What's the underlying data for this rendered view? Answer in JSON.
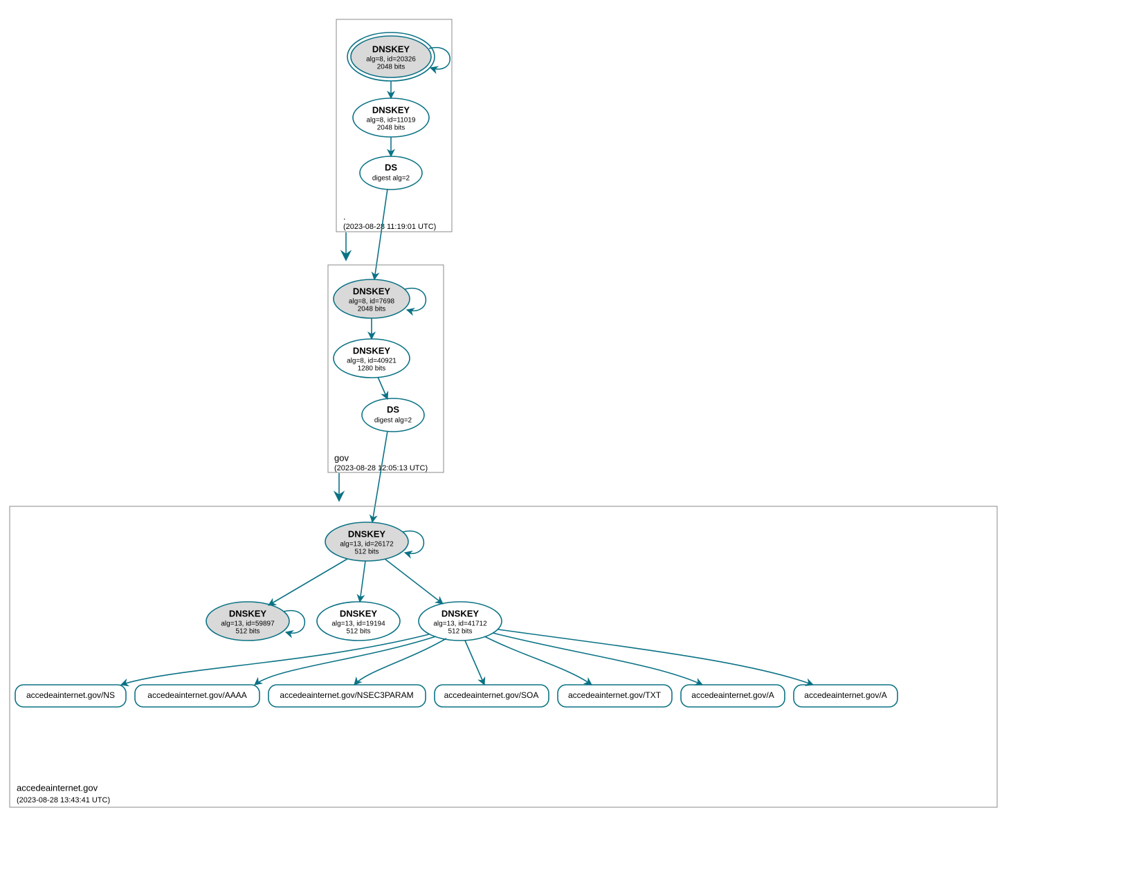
{
  "color_accent": "#0b7285",
  "color_fill_grey": "#d9d9d9",
  "zones": {
    "root": {
      "label": ".",
      "timestamp": "(2023-08-28 11:19:01 UTC)",
      "nodes": {
        "ksk": {
          "title": "DNSKEY",
          "line1": "alg=8, id=20326",
          "line2": "2048 bits"
        },
        "zsk": {
          "title": "DNSKEY",
          "line1": "alg=8, id=11019",
          "line2": "2048 bits"
        },
        "ds": {
          "title": "DS",
          "line1": "digest alg=2"
        }
      }
    },
    "gov": {
      "label": "gov",
      "timestamp": "(2023-08-28 12:05:13 UTC)",
      "nodes": {
        "ksk": {
          "title": "DNSKEY",
          "line1": "alg=8, id=7698",
          "line2": "2048 bits"
        },
        "zsk": {
          "title": "DNSKEY",
          "line1": "alg=8, id=40921",
          "line2": "1280 bits"
        },
        "ds": {
          "title": "DS",
          "line1": "digest alg=2"
        }
      }
    },
    "leaf": {
      "label": "accedeainternet.gov",
      "timestamp": "(2023-08-28 13:43:41 UTC)",
      "nodes": {
        "ksk": {
          "title": "DNSKEY",
          "line1": "alg=13, id=26172",
          "line2": "512 bits"
        },
        "key1": {
          "title": "DNSKEY",
          "line1": "alg=13, id=59897",
          "line2": "512 bits"
        },
        "key2": {
          "title": "DNSKEY",
          "line1": "alg=13, id=19194",
          "line2": "512 bits"
        },
        "key3": {
          "title": "DNSKEY",
          "line1": "alg=13, id=41712",
          "line2": "512 bits"
        }
      },
      "rr": [
        "accedeainternet.gov/NS",
        "accedeainternet.gov/AAAA",
        "accedeainternet.gov/NSEC3PARAM",
        "accedeainternet.gov/SOA",
        "accedeainternet.gov/TXT",
        "accedeainternet.gov/A",
        "accedeainternet.gov/A"
      ]
    }
  }
}
